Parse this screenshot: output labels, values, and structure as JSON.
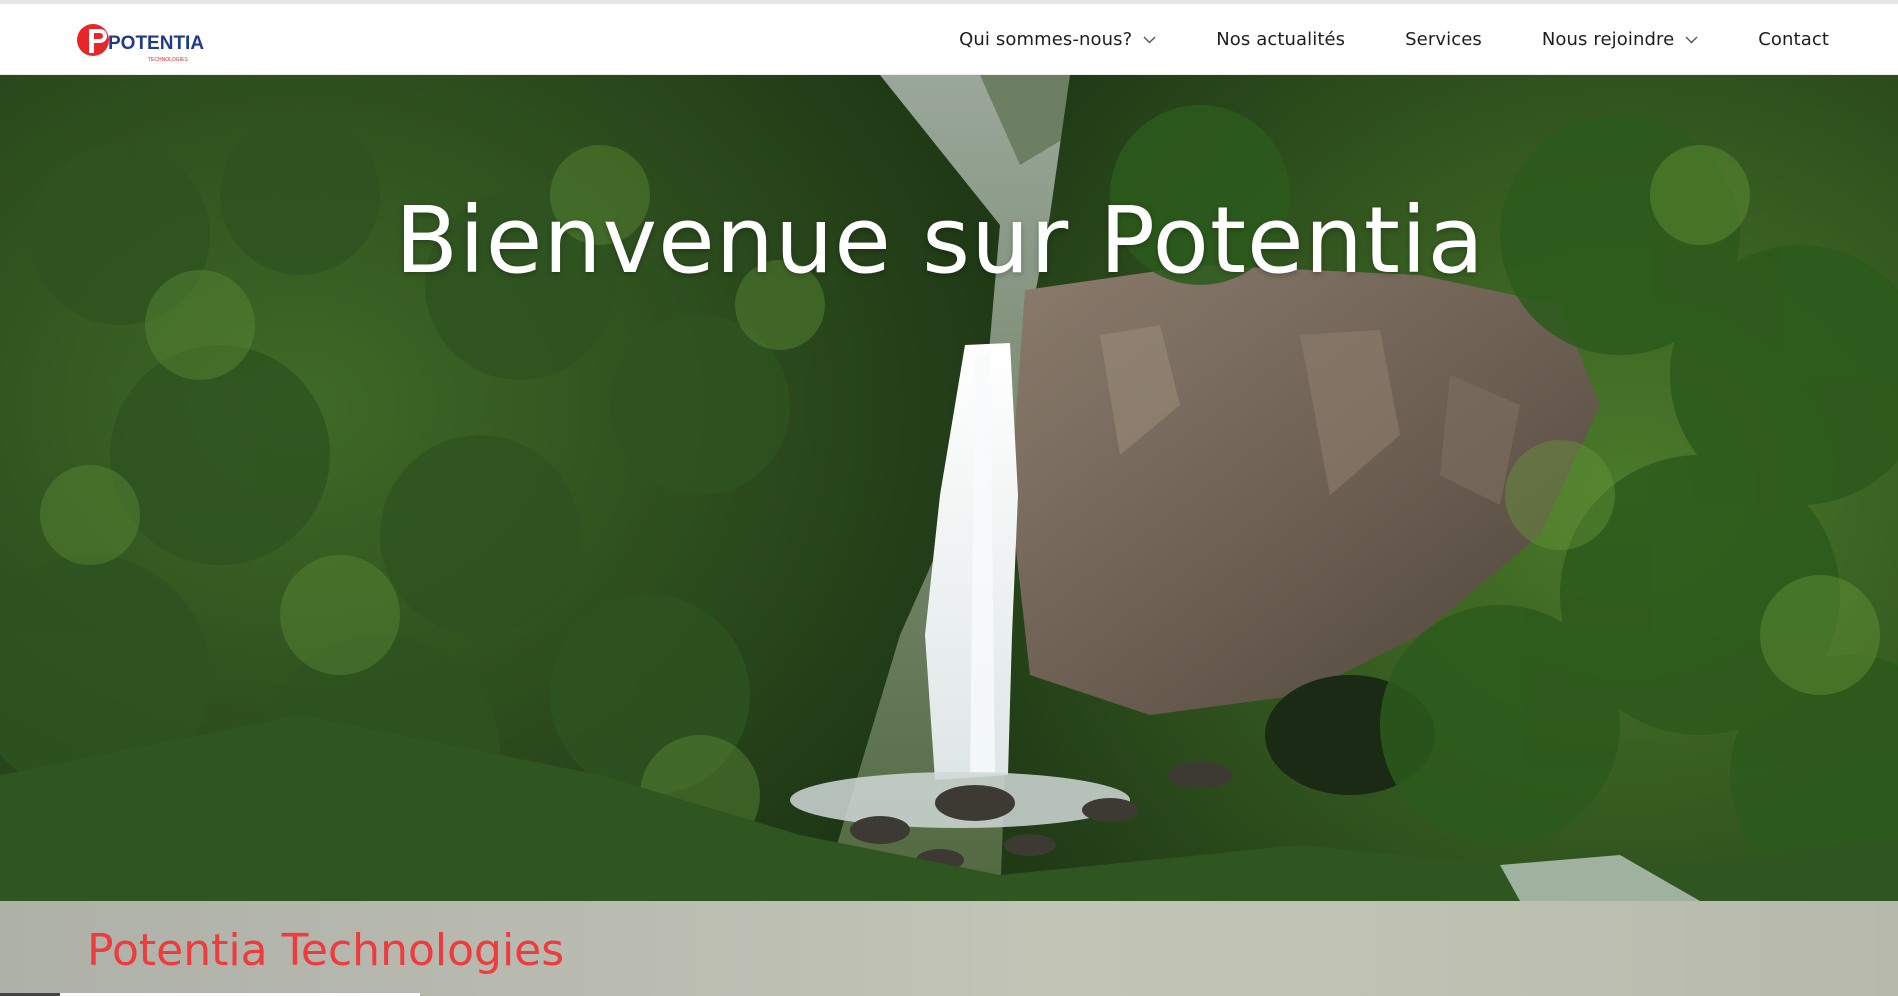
{
  "navbar": {
    "logo": {
      "text": "POTENTIA",
      "subtext": "TECHNOLOGIES",
      "brand_red": "#e8262a",
      "brand_blue": "#1f3c8c"
    },
    "items": [
      {
        "label": "Qui sommes-nous?",
        "has_dropdown": true
      },
      {
        "label": "Nos actualités",
        "has_dropdown": false
      },
      {
        "label": "Services",
        "has_dropdown": false
      },
      {
        "label": "Nous rejoindre",
        "has_dropdown": true
      },
      {
        "label": "Contact",
        "has_dropdown": false
      }
    ]
  },
  "hero": {
    "title": "Bienvenue sur Potentia"
  },
  "section": {
    "title": "Potentia Technologies",
    "title_color": "#ee3b3e"
  }
}
